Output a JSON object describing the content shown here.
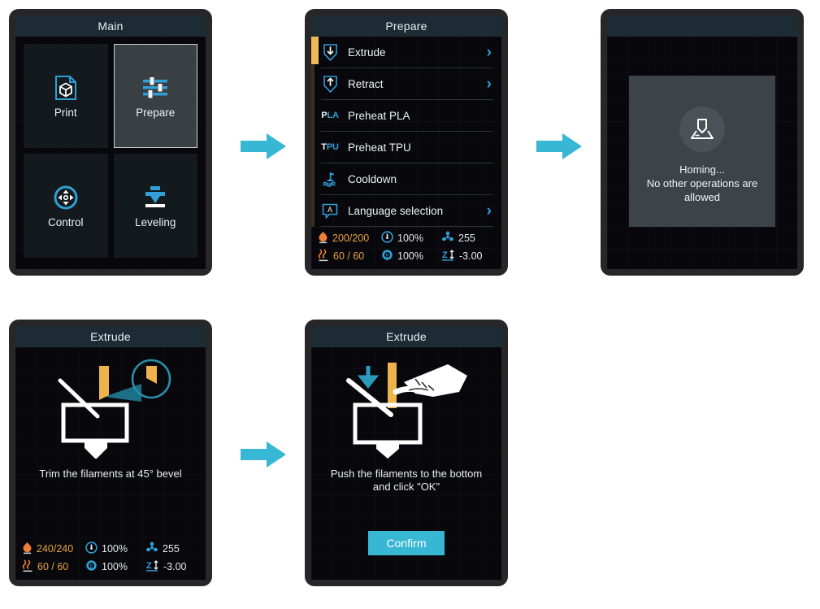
{
  "colors": {
    "accent_cyan": "#37b7d3",
    "accent_blue": "#2f9fd6",
    "amber": "#e8a33d",
    "scroll_thumb": "#f0b954",
    "titlebar": "#1d2c34",
    "screen_bg": "#07070c",
    "bezel": "#27272a"
  },
  "panels": {
    "main": {
      "title": "Main",
      "tiles": [
        {
          "label": "Print",
          "icon": "print-file-cube-icon",
          "selected": false
        },
        {
          "label": "Prepare",
          "icon": "sliders-icon",
          "selected": true
        },
        {
          "label": "Control",
          "icon": "dpad-circle-icon",
          "selected": false
        },
        {
          "label": "Leveling",
          "icon": "nozzle-down-bed-icon",
          "selected": false
        }
      ]
    },
    "prepare": {
      "title": "Prepare",
      "rows": [
        {
          "label": "Extrude",
          "icon": "extrude-arrow-down-icon",
          "chevron": "›",
          "has_chevron": true
        },
        {
          "label": "Retract",
          "icon": "retract-arrow-up-icon",
          "chevron": "›",
          "has_chevron": true
        },
        {
          "label": "Preheat PLA",
          "icon": "pla-badge",
          "badge_left": "P",
          "badge_right": "LA",
          "has_chevron": false
        },
        {
          "label": "Preheat TPU",
          "icon": "tpu-badge",
          "badge_left": "T",
          "badge_right": "PU",
          "has_chevron": false
        },
        {
          "label": "Cooldown",
          "icon": "cooldown-icon",
          "has_chevron": false
        },
        {
          "label": "Language selection",
          "icon": "language-a-icon",
          "chevron": "›",
          "has_chevron": true
        }
      ],
      "status": {
        "nozzle": "200/200",
        "bed": "60 / 60",
        "speed": "100%",
        "flow": "100%",
        "fan": "255",
        "zoffset": "-3.00"
      }
    },
    "homing": {
      "title": "",
      "icon": "homing-nozzle-icon",
      "message": "Homing...\nNo other operations are\nallowed"
    },
    "extrude_trim": {
      "title": "Extrude",
      "caption": "Trim the filaments at 45° bevel",
      "art": "filament-bevel-cut-illustration",
      "status": {
        "nozzle": "240/240",
        "bed": "60 / 60",
        "speed": "100%",
        "flow": "100%",
        "fan": "255",
        "zoffset": "-3.00"
      }
    },
    "extrude_push": {
      "title": "Extrude",
      "caption": "Push the filaments to the bottom and click \"OK\"",
      "art": "hand-push-filament-illustration",
      "confirm_label": "Confirm"
    }
  },
  "flow_arrows": [
    {
      "name": "arrow-main-to-prepare"
    },
    {
      "name": "arrow-prepare-to-homing"
    },
    {
      "name": "arrow-trim-to-push"
    }
  ]
}
